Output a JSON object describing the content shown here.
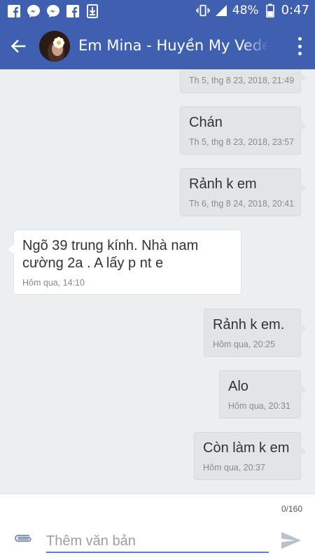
{
  "status_bar": {
    "left_icons": [
      "facebook-icon",
      "messenger-icon",
      "messenger-icon",
      "facebook-icon",
      "download-icon"
    ],
    "battery_percent": "48%",
    "time": "0:47"
  },
  "header": {
    "contact_name": "Em Mina - Huyền My Vedette"
  },
  "messages": [
    {
      "direction": "out",
      "text": "",
      "time": "Th 5, thg 8 23, 2018, 21:49"
    },
    {
      "direction": "out",
      "text": "Chán",
      "time": "Th 5, thg 8 23, 2018, 23:57"
    },
    {
      "direction": "out",
      "text": "Rảnh k em",
      "time": "Th 6, thg 8 24, 2018, 20:41"
    },
    {
      "direction": "in",
      "text": "Ngõ 39 trung kính. Nhà nam cường 2a . A lấy p nt e",
      "time": "Hôm qua, 14:10"
    },
    {
      "direction": "out",
      "text": "Rảnh k em.",
      "time": "Hôm qua, 20:25"
    },
    {
      "direction": "out",
      "text": "Alo",
      "time": "Hôm qua, 20:31"
    },
    {
      "direction": "out",
      "text": "Còn làm k em",
      "time": "Hôm qua, 20:37"
    }
  ],
  "composer": {
    "char_count": "0/160",
    "placeholder": "Thêm văn bản",
    "value": ""
  },
  "colors": {
    "app_bar": "#3f5fb0",
    "background": "#eceff1",
    "outgoing_bubble": "#e2e4e6",
    "incoming_bubble": "#ffffff",
    "input_underline": "#5b7fd6"
  }
}
